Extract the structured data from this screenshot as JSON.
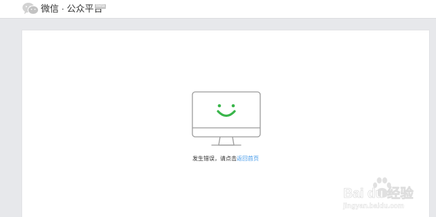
{
  "header": {
    "brand_title": "微信 · 公众平台",
    "beta_badge": "Beta"
  },
  "error": {
    "message": "发生错误，请点击",
    "link_label": "返回首页"
  },
  "watermark": {
    "line1": "Bai du 经验",
    "line2": "jingyan.baidu.com"
  },
  "colors": {
    "smile": "#39b54a",
    "link": "#459ae9",
    "page_bg": "#e7e8eb"
  },
  "icons": [
    "wechat-logo-icon",
    "monitor-smile-icon",
    "baidu-paw-icon"
  ]
}
